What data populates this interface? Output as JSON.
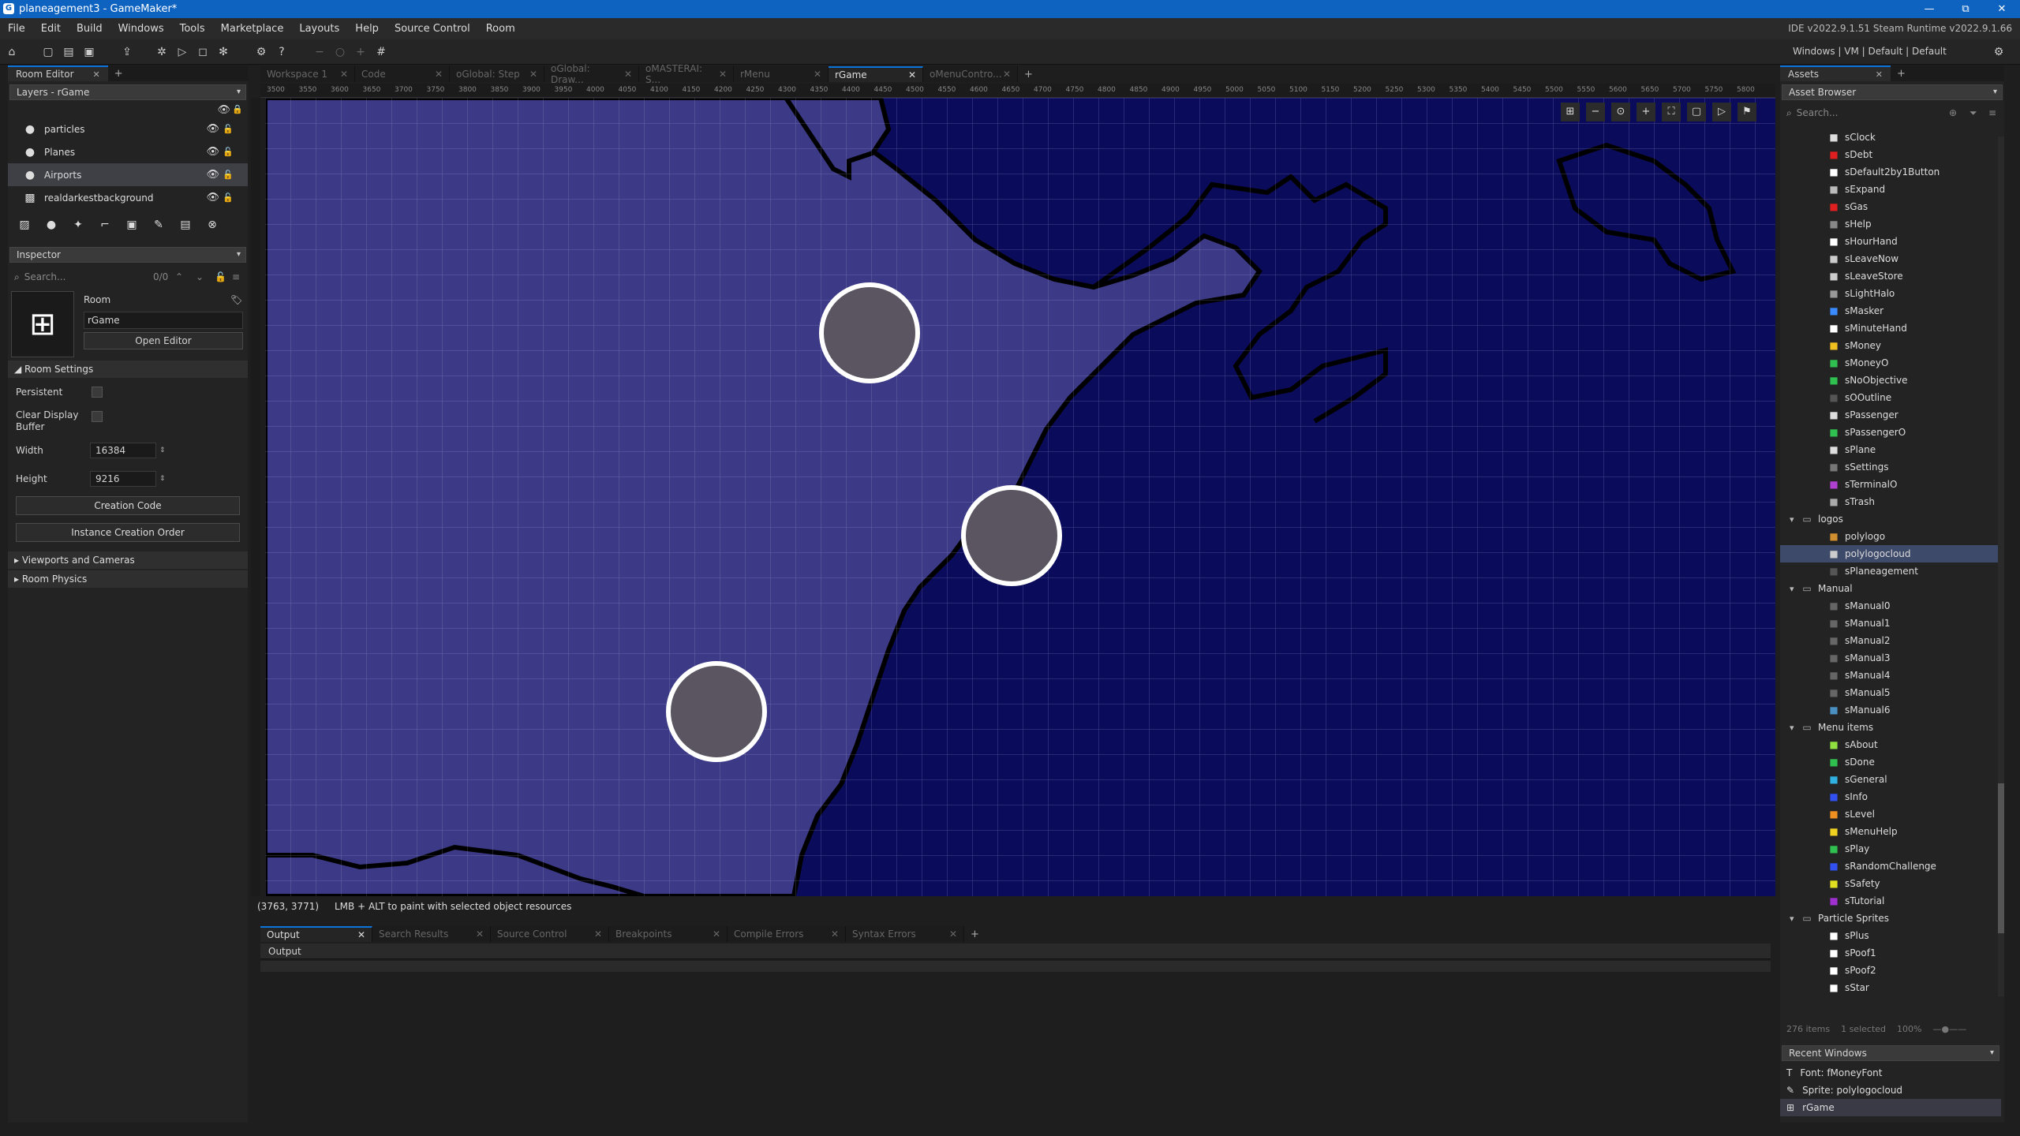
{
  "titlebar": {
    "title": "planeagement3 - GameMaker*",
    "min": "—",
    "max": "⧉",
    "close": "✕"
  },
  "menu": {
    "items": [
      "File",
      "Edit",
      "Build",
      "Windows",
      "Tools",
      "Marketplace",
      "Layouts",
      "Help",
      "Source Control",
      "Room"
    ],
    "version": "IDE v2022.9.1.51 Steam  Runtime v2022.9.1.66"
  },
  "toolbar": {
    "right": "Windows  |  VM  |  Default  |  Default"
  },
  "room_editor": {
    "tab_label": "Room Editor",
    "layers_dropdown": "Layers - rGame",
    "layers": [
      {
        "name": "particles",
        "icon": "instance-layer-icon"
      },
      {
        "name": "Planes",
        "icon": "instance-layer-icon"
      },
      {
        "name": "Airports",
        "icon": "instance-layer-icon"
      },
      {
        "name": "realdarkestbackground",
        "icon": "background-layer-icon"
      }
    ],
    "inspector_dropdown": "Inspector",
    "search_placeholder": "Search...",
    "search_count": "0/0",
    "room_label": "Room",
    "room_name": "rGame",
    "open_editor": "Open Editor",
    "room_settings": "Room Settings",
    "persistent": "Persistent",
    "clear_display_line1": "Clear Display",
    "clear_display_line2": "Buffer",
    "width_label": "Width",
    "width_value": "16384",
    "height_label": "Height",
    "height_value": "9216",
    "creation_code": "Creation Code",
    "instance_order": "Instance Creation Order",
    "viewports": "Viewports and Cameras",
    "physics": "Room Physics"
  },
  "doc_tabs": [
    {
      "label": "Workspace 1",
      "active": false
    },
    {
      "label": "Code",
      "active": false
    },
    {
      "label": "oGlobal: Step",
      "active": false
    },
    {
      "label": "oGlobal: Draw...",
      "active": false
    },
    {
      "label": "oMASTERAI: S...",
      "active": false
    },
    {
      "label": "rMenu",
      "active": false
    },
    {
      "label": "rGame",
      "active": true
    },
    {
      "label": "oMenuContro...",
      "active": false
    }
  ],
  "ruler_ticks": [
    "3500",
    "3550",
    "3600",
    "3650",
    "3700",
    "3750",
    "3800",
    "3850",
    "3900",
    "3950",
    "4000",
    "4050",
    "4100",
    "4150",
    "4200",
    "4250",
    "4300",
    "4350",
    "4400",
    "4450",
    "4500",
    "4550",
    "4600",
    "4650",
    "4700",
    "4750",
    "4800",
    "4850",
    "4900",
    "4950",
    "5000",
    "5050",
    "5100",
    "5150",
    "5200",
    "5250",
    "5300",
    "5350",
    "5400",
    "5450",
    "5500",
    "5550",
    "5600",
    "5650",
    "5700",
    "5750",
    "5800"
  ],
  "status": {
    "coords": "(3763, 3771)",
    "hint": "LMB + ALT to paint with selected object resources"
  },
  "output_tabs": [
    {
      "label": "Output",
      "active": true
    },
    {
      "label": "Search Results",
      "active": false
    },
    {
      "label": "Source Control",
      "active": false
    },
    {
      "label": "Breakpoints",
      "active": false
    },
    {
      "label": "Compile Errors",
      "active": false
    },
    {
      "label": "Syntax Errors",
      "active": false
    }
  ],
  "output_header": "Output",
  "assets": {
    "tab_label": "Assets",
    "dropdown": "Asset Browser",
    "search_placeholder": "Search...",
    "items": [
      {
        "name": "sClock",
        "icon": "clock-sprite-icon",
        "color": "#dddddd",
        "indent": 2
      },
      {
        "name": "sDebt",
        "icon": "sprite-icon",
        "color": "#e02020",
        "indent": 2
      },
      {
        "name": "sDefault2by1Button",
        "icon": "sprite-icon",
        "color": "#ffffff",
        "indent": 2
      },
      {
        "name": "sExpand",
        "icon": "sprite-icon",
        "color": "#bbbbbb",
        "indent": 2
      },
      {
        "name": "sGas",
        "icon": "sprite-icon",
        "color": "#e02020",
        "indent": 2
      },
      {
        "name": "sHelp",
        "icon": "sprite-icon",
        "color": "#888888",
        "indent": 2
      },
      {
        "name": "sHourHand",
        "icon": "sprite-icon",
        "color": "#ffffff",
        "indent": 2
      },
      {
        "name": "sLeaveNow",
        "icon": "sprite-icon",
        "color": "#cccccc",
        "indent": 2
      },
      {
        "name": "sLeaveStore",
        "icon": "sprite-icon",
        "color": "#cccccc",
        "indent": 2
      },
      {
        "name": "sLightHalo",
        "icon": "sprite-icon",
        "color": "#999999",
        "indent": 2
      },
      {
        "name": "sMasker",
        "icon": "sprite-icon",
        "color": "#3a8bff",
        "indent": 2
      },
      {
        "name": "sMinuteHand",
        "icon": "sprite-icon",
        "color": "#ffffff",
        "indent": 2
      },
      {
        "name": "sMoney",
        "icon": "sprite-icon",
        "color": "#f0c020",
        "indent": 2
      },
      {
        "name": "sMoneyO",
        "icon": "sprite-icon",
        "color": "#30c050",
        "indent": 2
      },
      {
        "name": "sNoObjective",
        "icon": "sprite-icon",
        "color": "#30c050",
        "indent": 2
      },
      {
        "name": "sOOutline",
        "icon": "sprite-icon",
        "color": "#555555",
        "indent": 2
      },
      {
        "name": "sPassenger",
        "icon": "sprite-icon",
        "color": "#dddddd",
        "indent": 2
      },
      {
        "name": "sPassengerO",
        "icon": "sprite-icon",
        "color": "#30c050",
        "indent": 2
      },
      {
        "name": "sPlane",
        "icon": "sprite-icon",
        "color": "#dddddd",
        "indent": 2
      },
      {
        "name": "sSettings",
        "icon": "sprite-icon",
        "color": "#777777",
        "indent": 2
      },
      {
        "name": "sTerminalO",
        "icon": "sprite-icon",
        "color": "#b040d0",
        "indent": 2
      },
      {
        "name": "sTrash",
        "icon": "sprite-icon",
        "color": "#aaaaaa",
        "indent": 2
      },
      {
        "name": "logos",
        "icon": "folder-icon",
        "color": "#aaaaaa",
        "indent": 1,
        "folder": true
      },
      {
        "name": "polylogo",
        "icon": "sprite-icon",
        "color": "#d09030",
        "indent": 2
      },
      {
        "name": "polylogocloud",
        "icon": "sprite-icon",
        "color": "#cccccc",
        "indent": 2,
        "selected": true
      },
      {
        "name": "sPlaneagement",
        "icon": "sprite-icon",
        "color": "#555555",
        "indent": 2
      },
      {
        "name": "Manual",
        "icon": "folder-icon",
        "color": "#aaaaaa",
        "indent": 1,
        "folder": true
      },
      {
        "name": "sManual0",
        "icon": "sprite-icon",
        "color": "#666666",
        "indent": 2
      },
      {
        "name": "sManual1",
        "icon": "sprite-icon",
        "color": "#666666",
        "indent": 2
      },
      {
        "name": "sManual2",
        "icon": "sprite-icon",
        "color": "#666666",
        "indent": 2
      },
      {
        "name": "sManual3",
        "icon": "sprite-icon",
        "color": "#666666",
        "indent": 2
      },
      {
        "name": "sManual4",
        "icon": "sprite-icon",
        "color": "#666666",
        "indent": 2
      },
      {
        "name": "sManual5",
        "icon": "sprite-icon",
        "color": "#666666",
        "indent": 2
      },
      {
        "name": "sManual6",
        "icon": "sprite-icon",
        "color": "#4a90c0",
        "indent": 2
      },
      {
        "name": "Menu items",
        "icon": "folder-icon",
        "color": "#aaaaaa",
        "indent": 1,
        "folder": true
      },
      {
        "name": "sAbout",
        "icon": "sprite-icon",
        "color": "#90e040",
        "indent": 2
      },
      {
        "name": "sDone",
        "icon": "sprite-icon",
        "color": "#30c050",
        "indent": 2
      },
      {
        "name": "sGeneral",
        "icon": "sprite-icon",
        "color": "#30b0e0",
        "indent": 2
      },
      {
        "name": "sInfo",
        "icon": "sprite-icon",
        "color": "#3050f0",
        "indent": 2
      },
      {
        "name": "sLevel",
        "icon": "sprite-icon",
        "color": "#f09020",
        "indent": 2
      },
      {
        "name": "sMenuHelp",
        "icon": "sprite-icon",
        "color": "#f0d020",
        "indent": 2
      },
      {
        "name": "sPlay",
        "icon": "sprite-icon",
        "color": "#30c050",
        "indent": 2
      },
      {
        "name": "sRandomChallenge",
        "icon": "sprite-icon",
        "color": "#3050f0",
        "indent": 2
      },
      {
        "name": "sSafety",
        "icon": "sprite-icon",
        "color": "#e0e020",
        "indent": 2
      },
      {
        "name": "sTutorial",
        "icon": "sprite-icon",
        "color": "#a030d0",
        "indent": 2
      },
      {
        "name": "Particle Sprites",
        "icon": "folder-icon",
        "color": "#aaaaaa",
        "indent": 1,
        "folder": true
      },
      {
        "name": "sPlus",
        "icon": "sprite-icon",
        "color": "#ffffff",
        "indent": 2
      },
      {
        "name": "sPoof1",
        "icon": "sprite-icon",
        "color": "#ffffff",
        "indent": 2
      },
      {
        "name": "sPoof2",
        "icon": "sprite-icon",
        "color": "#ffffff",
        "indent": 2
      },
      {
        "name": "sStar",
        "icon": "sprite-icon",
        "color": "#ffffff",
        "indent": 2
      }
    ],
    "footer_items": "276 items",
    "footer_selected": "1 selected",
    "footer_zoom": "100%"
  },
  "recent": {
    "dropdown": "Recent Windows",
    "items": [
      {
        "label": "Font: fMoneyFont",
        "icon": "font-icon"
      },
      {
        "label": "Sprite: polylogocloud",
        "icon": "sprite-icon"
      },
      {
        "label": "rGame",
        "icon": "room-icon",
        "selected": true
      }
    ]
  },
  "colors": {
    "accent": "#0a74da",
    "land": "#3c3a86",
    "sea": "#0b0b5c",
    "airport_fill": "#5a5560"
  }
}
